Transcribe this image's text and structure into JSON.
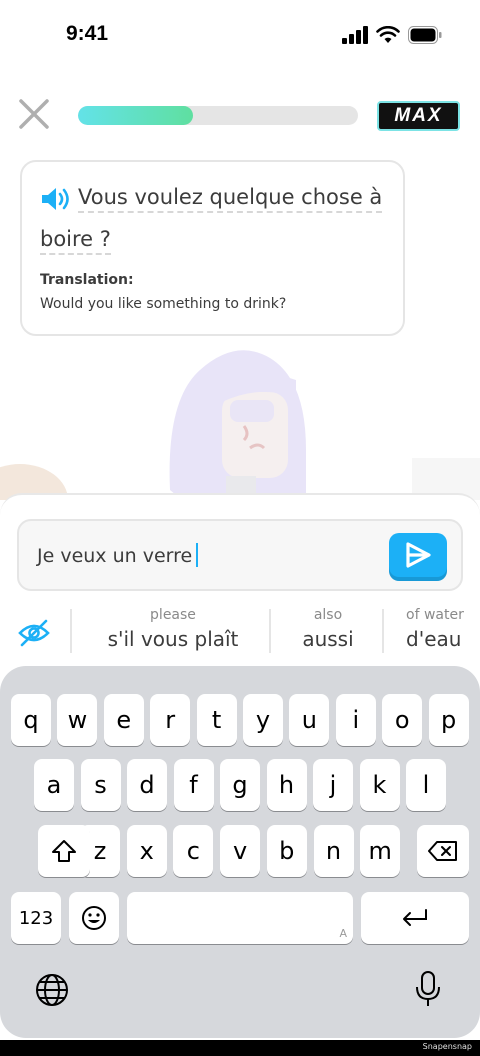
{
  "status_bar": {
    "time": "9:41"
  },
  "top_bar": {
    "progress": 0.41,
    "badge": "MAX"
  },
  "prompt": {
    "line1": "Vous voulez quelque chose à",
    "line2": "boire ?",
    "translation_label": "Translation:",
    "translation": "Would you like something to drink?"
  },
  "answer": {
    "value": "Je veux un verre"
  },
  "suggestions": [
    {
      "hint": "please",
      "word": "s'il vous plaît"
    },
    {
      "hint": "also",
      "word": "aussi"
    },
    {
      "hint": "of water",
      "word": "d'eau"
    }
  ],
  "keyboard": {
    "row1": [
      "q",
      "w",
      "e",
      "r",
      "t",
      "y",
      "u",
      "i",
      "o",
      "p"
    ],
    "row2": [
      "a",
      "s",
      "d",
      "f",
      "g",
      "h",
      "j",
      "k",
      "l"
    ],
    "row3": [
      "z",
      "x",
      "c",
      "v",
      "b",
      "n",
      "m"
    ],
    "numbers_label": "123",
    "space_hint": "A"
  },
  "watermark": "Snapensnap",
  "colors": {
    "accent": "#1cb0f6",
    "progress": "#5fdfc0"
  }
}
